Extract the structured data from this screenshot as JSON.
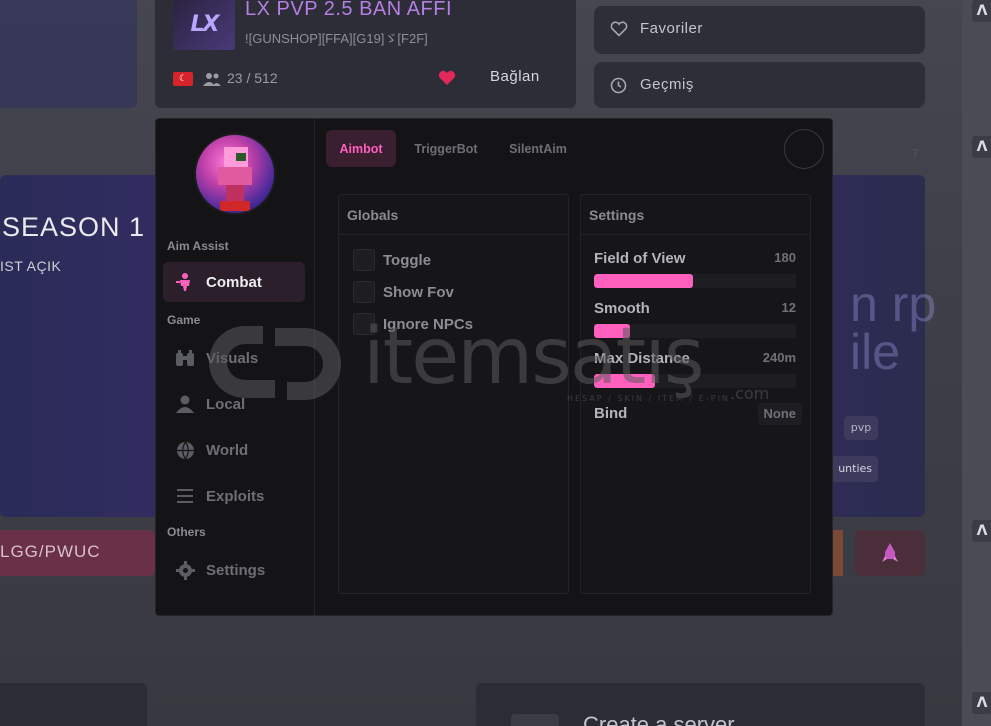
{
  "background": {
    "server": {
      "title": "LX PVP 2.5 BAN AFFI",
      "tags": "![GUNSHOP][FFA][G19]ゞ[F2F]",
      "flag": "TR",
      "players": "23 / 512",
      "connect_label": "Bağlan"
    },
    "favorites_label": "Favoriler",
    "history_label": "Geçmiş",
    "banner": {
      "title": "SEASON 1 D",
      "subtitle": "IST AÇIK",
      "right_text": "n rp ile",
      "tag_pvp": "pvp",
      "tag_unities": "unties"
    },
    "gg_link": "LGG/PWUC",
    "create_server": "Create a server",
    "strip_icon": "Λ"
  },
  "menu": {
    "sidebar": {
      "sections": {
        "aim_assist": "Aim Assist",
        "game": "Game",
        "others": "Others"
      },
      "items": [
        {
          "label": "Combat",
          "icon": "combat-icon",
          "active": true
        },
        {
          "label": "Visuals",
          "icon": "binoculars-icon",
          "active": false
        },
        {
          "label": "Local",
          "icon": "user-icon",
          "active": false
        },
        {
          "label": "World",
          "icon": "globe-icon",
          "active": false
        },
        {
          "label": "Exploits",
          "icon": "menu-lines-icon",
          "active": false
        },
        {
          "label": "Settings",
          "icon": "gear-icon",
          "active": false
        }
      ]
    },
    "tabs": [
      {
        "label": "Aimbot",
        "active": true
      },
      {
        "label": "TriggerBot",
        "active": false
      },
      {
        "label": "SilentAim",
        "active": false
      }
    ],
    "help": "?",
    "globals": {
      "title": "Globals",
      "toggles": [
        {
          "label": "Toggle",
          "checked": false
        },
        {
          "label": "Show Fov",
          "checked": false
        },
        {
          "label": "Ignore NPCs",
          "checked": false
        }
      ]
    },
    "settings": {
      "title": "Settings",
      "sliders": [
        {
          "label": "Field of View",
          "value": "180",
          "fill_fraction": 0.49
        },
        {
          "label": "Smooth",
          "value": "12",
          "fill_fraction": 0.18
        },
        {
          "label": "Max Distance",
          "value": "240m",
          "fill_fraction": 0.3
        }
      ],
      "bind": {
        "label": "Bind",
        "value": "None"
      }
    },
    "accent_color": "#ff5fbd"
  },
  "watermark": {
    "text": "itemsatış",
    "suffix": ".com",
    "tagline": "HESAP / SKIN / ITEM / E-PIN"
  }
}
